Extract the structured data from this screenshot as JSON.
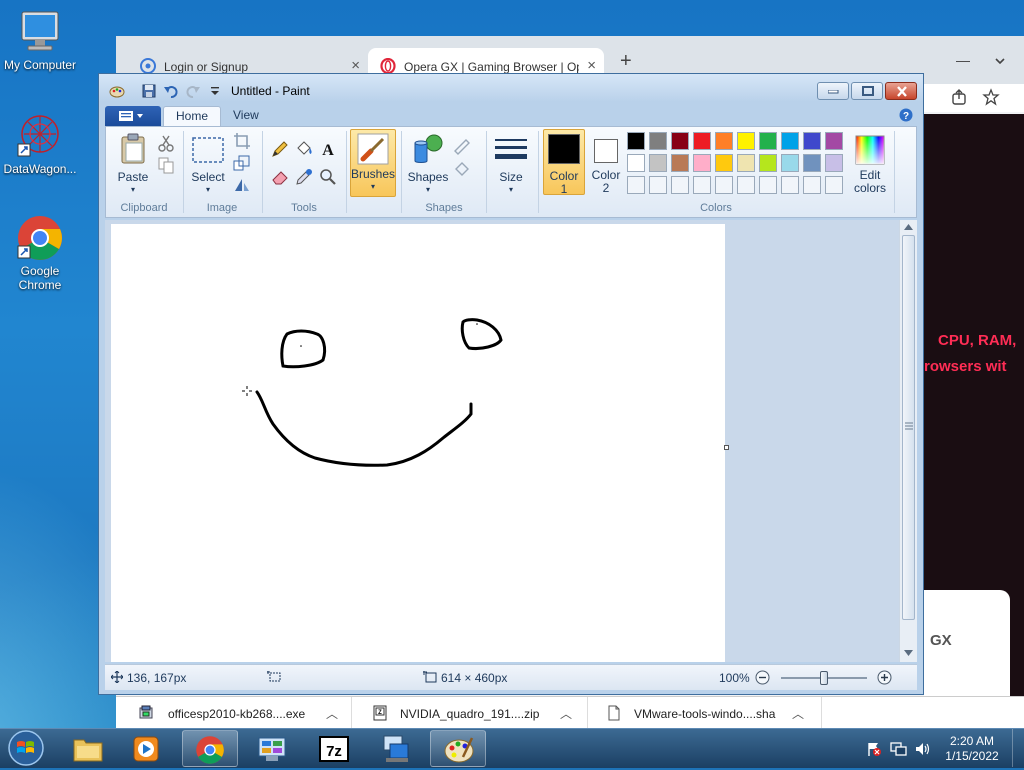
{
  "desktop": {
    "icons": [
      {
        "label": "My Computer"
      },
      {
        "label": "DataWagon..."
      },
      {
        "label": "Google Chrome"
      }
    ]
  },
  "browser": {
    "tabs": [
      {
        "label": "Login or Signup",
        "active": false
      },
      {
        "label": "Opera GX | Gaming Browser | Oper",
        "active": true
      }
    ],
    "new_tab": "+",
    "close": "×",
    "window_minimize": "—",
    "page_text_line1": "CPU, RAM,",
    "page_text_line2": "rowsers wit",
    "page_logo_text": "GX"
  },
  "paint": {
    "title": "Untitled - Paint",
    "tabs": [
      {
        "label": "Home"
      },
      {
        "label": "View"
      }
    ],
    "groups": {
      "clipboard": "Clipboard",
      "image": "Image",
      "tools": "Tools",
      "shapes": "Shapes",
      "colors": "Colors"
    },
    "buttons": {
      "paste": "Paste",
      "select": "Select",
      "brushes": "Brushes",
      "shapes": "Shapes",
      "size": "Size",
      "color1_line1": "Color",
      "color1_line2": "1",
      "color2_line1": "Color",
      "color2_line2": "2",
      "edit_colors_line1": "Edit",
      "edit_colors_line2": "colors"
    },
    "palette_row1": [
      "#000000",
      "#7f7f7f",
      "#880015",
      "#ed1c24",
      "#ff7f27",
      "#fff200",
      "#22b14c",
      "#00a2e8",
      "#3f48cc",
      "#a349a4"
    ],
    "palette_row2": [
      "#ffffff",
      "#c3c3c3",
      "#b97a57",
      "#ffaec9",
      "#ffc90e",
      "#efe4b0",
      "#b5e61d",
      "#99d9ea",
      "#7092be",
      "#c8bfe7"
    ],
    "color1": "#000000",
    "color2": "#ffffff",
    "status": {
      "cursor_pos": "136, 167px",
      "image_size": "614 × 460px",
      "zoom": "100%",
      "zoom_level_fraction": 0.5
    }
  },
  "downloads": [
    {
      "label": "officesp2010-kb268....exe"
    },
    {
      "label": "NVIDIA_quadro_191....zip"
    },
    {
      "label": "VMware-tools-windo....sha"
    }
  ],
  "taskbar": {
    "time": "2:20 AM",
    "date": "1/15/2022"
  }
}
